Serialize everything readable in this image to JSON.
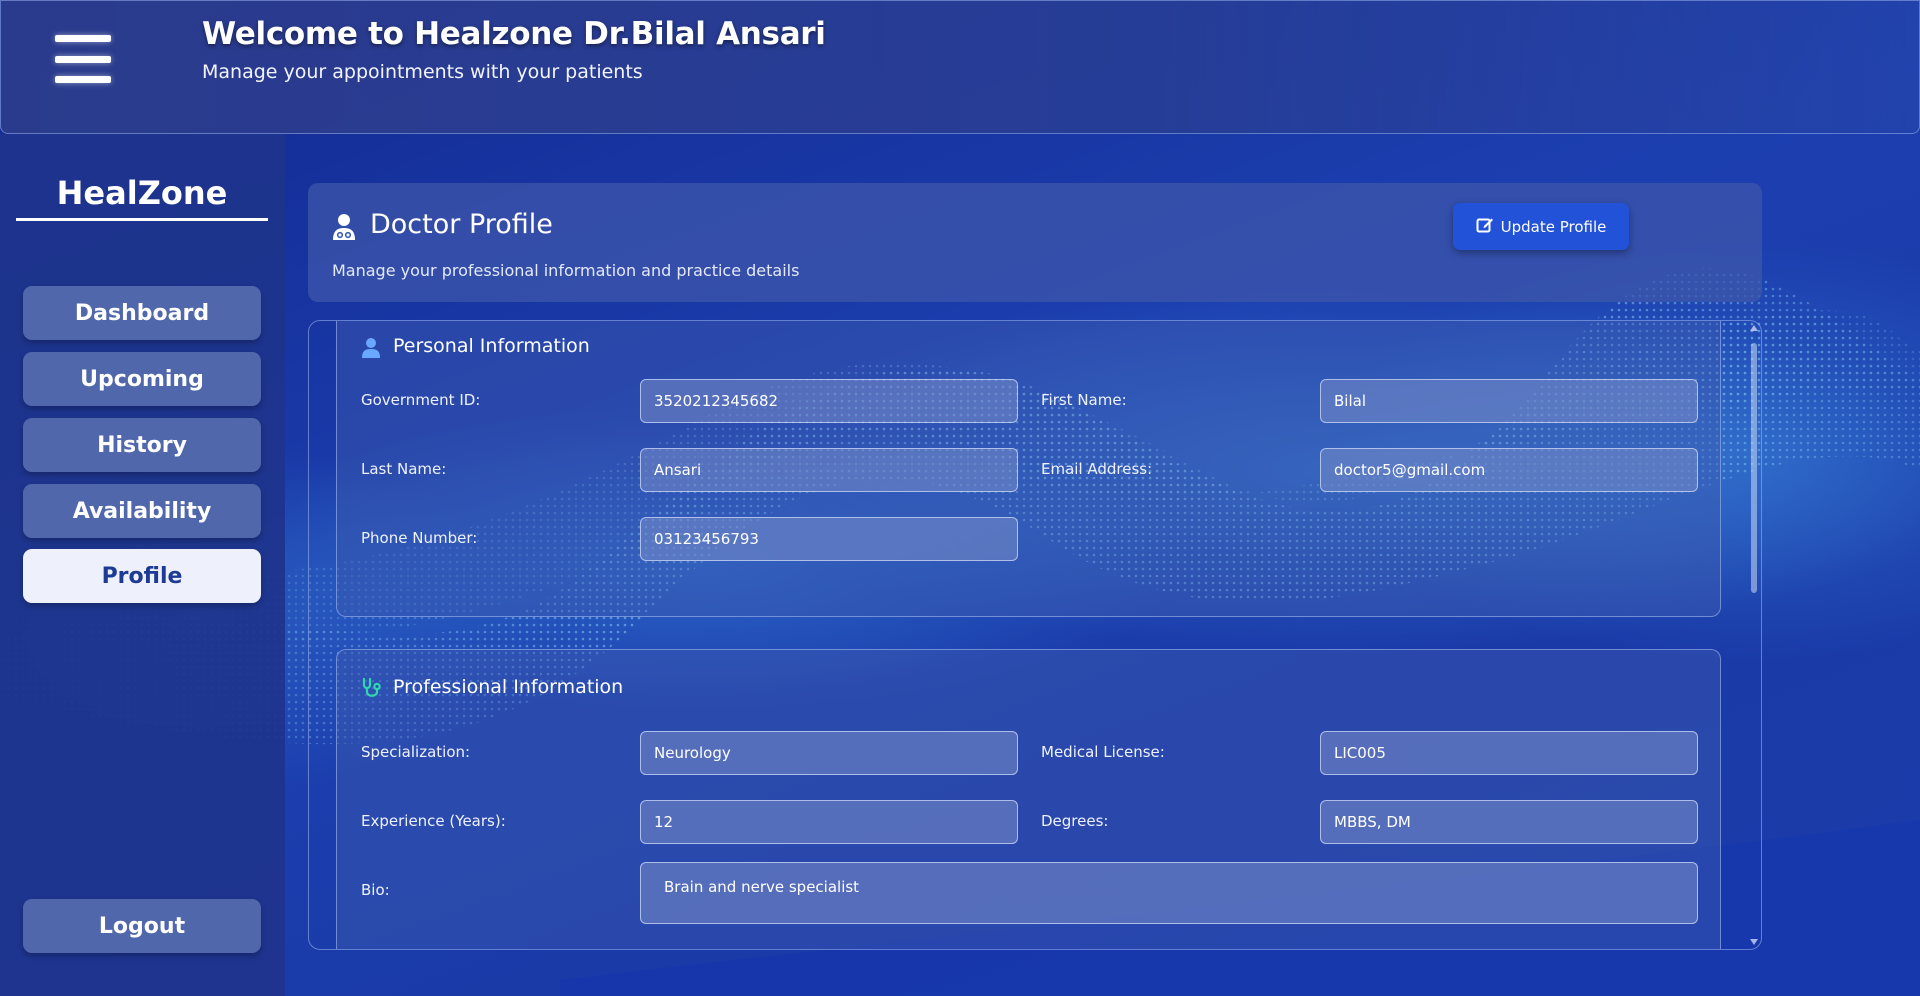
{
  "header": {
    "title": "Welcome to Healzone  Dr.Bilal Ansari",
    "subtitle": "Manage your appointments with your patients",
    "menu_icon": "hamburger-menu-icon"
  },
  "sidebar": {
    "brand": "HealZone",
    "items": [
      {
        "label": "Dashboard",
        "active": false
      },
      {
        "label": "Upcoming",
        "active": false
      },
      {
        "label": "History",
        "active": false
      },
      {
        "label": "Availability",
        "active": false
      },
      {
        "label": "Profile",
        "active": true
      }
    ],
    "logout_label": "Logout"
  },
  "profile_header": {
    "icon": "doctor-icon",
    "title": "Doctor Profile",
    "description": "Manage your professional information and practice details",
    "update_button": {
      "label": "Update Profile",
      "icon": "edit-icon"
    }
  },
  "personal": {
    "title": "Personal Information",
    "icon": "user-icon",
    "fields": {
      "government_id": {
        "label": "Government ID:",
        "value": "3520212345682"
      },
      "first_name": {
        "label": "First Name:",
        "value": "Bilal"
      },
      "last_name": {
        "label": "Last Name:",
        "value": "Ansari"
      },
      "email": {
        "label": "Email Address:",
        "value": "doctor5@gmail.com"
      },
      "phone": {
        "label": "Phone Number:",
        "value": "03123456793"
      }
    }
  },
  "professional": {
    "title": "Professional Information",
    "icon": "stethoscope-icon",
    "fields": {
      "specialization": {
        "label": "Specialization:",
        "value": "Neurology"
      },
      "license": {
        "label": "Medical License:",
        "value": "LIC005"
      },
      "experience": {
        "label": "Experience (Years):",
        "value": "12"
      },
      "degrees": {
        "label": "Degrees:",
        "value": "MBBS, DM"
      },
      "bio": {
        "label": "Bio:",
        "value": "Brain and nerve specialist"
      }
    }
  },
  "colors": {
    "background": "#1a3aa8",
    "sidebar": "#1e348c",
    "accent_button": "#2252d8",
    "active_nav_bg": "#eef1fb",
    "active_nav_text": "#1d3a95",
    "stethoscope": "#2fd6b0"
  }
}
